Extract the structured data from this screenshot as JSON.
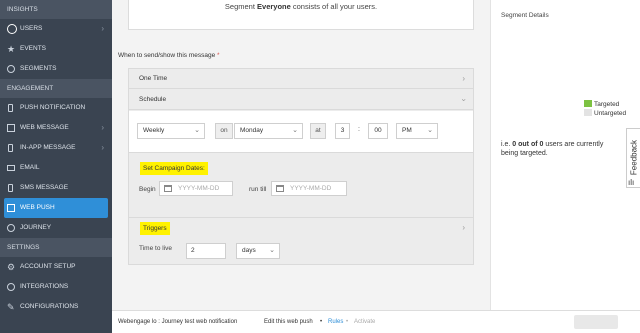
{
  "sidebar": {
    "insights": "INSIGHTS",
    "users": "USERS",
    "events": "EVENTS",
    "segments": "SEGMENTS",
    "engagement": "ENGAGEMENT",
    "push": "PUSH NOTIFICATION",
    "web_message": "WEB MESSAGE",
    "in_app": "IN-APP MESSAGE",
    "email": "EMAIL",
    "sms": "SMS MESSAGE",
    "web_push": "WEB PUSH",
    "journey": "JOURNEY",
    "settings": "SETTINGS",
    "account": "ACCOUNT SETUP",
    "integrations": "INTEGRATIONS",
    "configurations": "CONFIGURATIONS"
  },
  "segment": {
    "prefix": "Segment ",
    "name": "Everyone",
    "suffix": " consists of all your users."
  },
  "when": {
    "label": "When to send/show this message ",
    "required": "*"
  },
  "sections": {
    "one_time": "One Time",
    "schedule": "Schedule",
    "dates_title": "Set Campaign Dates:",
    "triggers": "Triggers"
  },
  "schedule": {
    "frequency": "Weekly",
    "on_label": "on",
    "day": "Monday",
    "at_label": "at",
    "hour": "3",
    "colon": ":",
    "minute": "00",
    "ampm": "PM"
  },
  "dates": {
    "begin_label": "Begin",
    "begin_placeholder": "YYYY-MM-DD",
    "until_label": "run till",
    "until_placeholder": "YYYY-MM-DD"
  },
  "ttl": {
    "label": "Time to live",
    "value": "2",
    "unit": "days"
  },
  "right": {
    "title": "Segment Details",
    "targeted": "Targeted",
    "untargeted": "Untargeted",
    "targeted_color": "#7dc242",
    "untargeted_color": "#e3e3e3",
    "summary_prefix": "i.e. ",
    "summary_bold": "0 out of 0",
    "summary_suffix": " users are currently being targeted."
  },
  "feedback": "Feedback",
  "footer": {
    "title": "Webengage lo : Journey test web notification",
    "edit": "Edit this web push",
    "sep": "•",
    "rules": "Rules",
    "activate": "Activate"
  }
}
